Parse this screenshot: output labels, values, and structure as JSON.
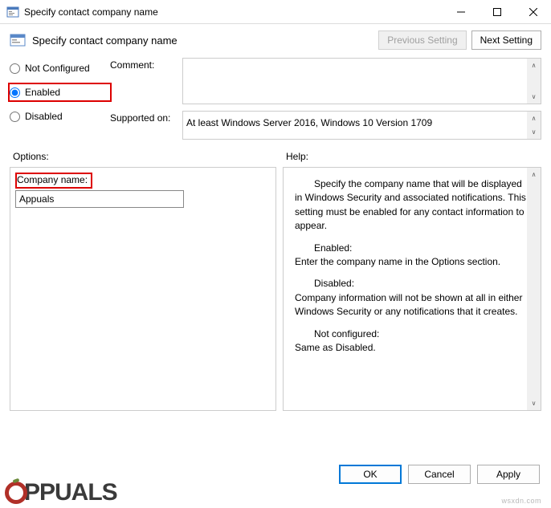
{
  "window": {
    "title": "Specify contact company name"
  },
  "header": {
    "title": "Specify contact company name",
    "prev_button": "Previous Setting",
    "next_button": "Next Setting"
  },
  "radio": {
    "not_configured": "Not Configured",
    "enabled": "Enabled",
    "disabled": "Disabled",
    "selected": "enabled"
  },
  "fields": {
    "comment_label": "Comment:",
    "comment_value": "",
    "supported_label": "Supported on:",
    "supported_value": "At least Windows Server 2016, Windows 10 Version 1709"
  },
  "panels": {
    "options_label": "Options:",
    "help_label": "Help:"
  },
  "options": {
    "company_label": "Company name:",
    "company_value": "Appuals"
  },
  "help": {
    "p1": "Specify the company name that will be displayed in Windows Security and associated notifications. This setting must be enabled for any contact information to appear.",
    "p2a": "Enabled:",
    "p2b": "Enter the company name in the Options section.",
    "p3a": "Disabled:",
    "p3b": "Company information will not be shown at all in either Windows Security or any notifications that it creates.",
    "p4a": "Not configured:",
    "p4b": "Same as Disabled."
  },
  "footer": {
    "ok": "OK",
    "cancel": "Cancel",
    "apply": "Apply"
  },
  "watermark": "wsxdn.com",
  "logo_text": "PPUALS"
}
